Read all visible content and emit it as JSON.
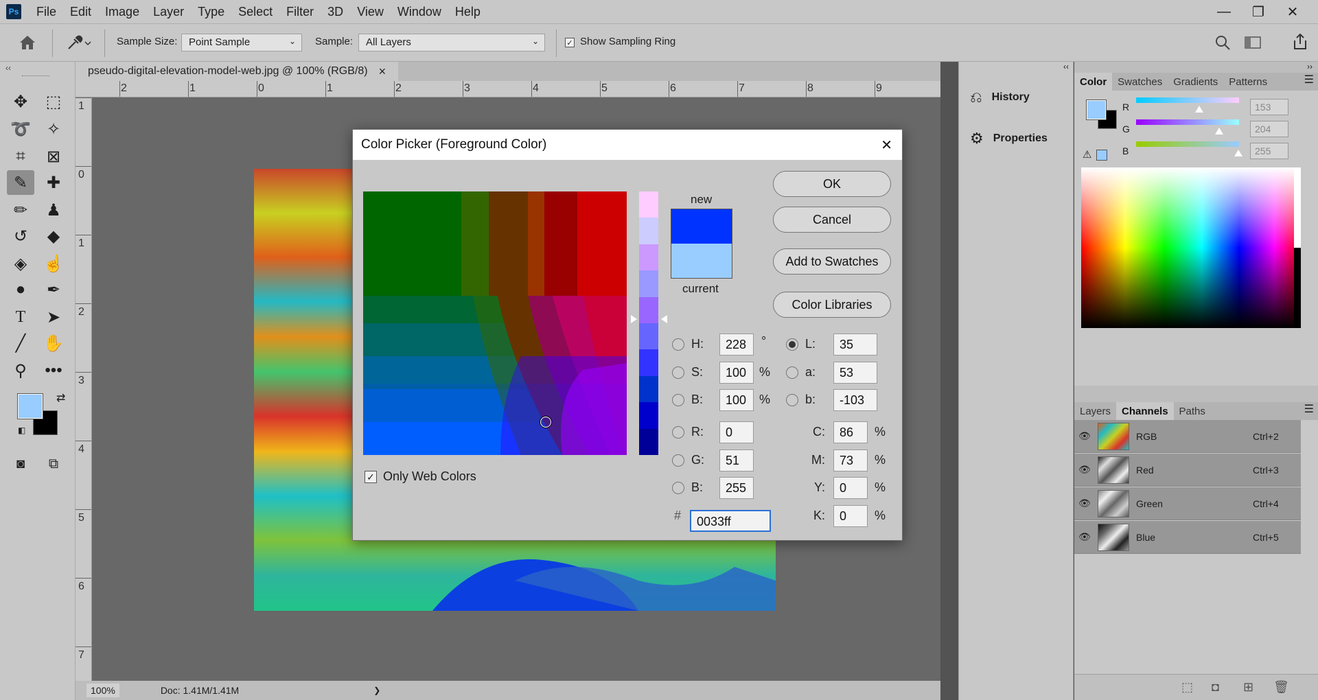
{
  "app": {
    "logo": "Ps"
  },
  "menu": [
    "File",
    "Edit",
    "Image",
    "Layer",
    "Type",
    "Select",
    "Filter",
    "3D",
    "View",
    "Window",
    "Help"
  ],
  "window_controls": {
    "minimize": "—",
    "restore": "❐",
    "close": "✕"
  },
  "options": {
    "sample_size_label": "Sample Size:",
    "sample_size_value": "Point Sample",
    "sample_label": "Sample:",
    "sample_value": "All Layers",
    "show_ring_label": "Show Sampling Ring",
    "show_ring_checked": true
  },
  "document": {
    "tab_title": "pseudo-digital-elevation-model-web.jpg @ 100% (RGB/8)",
    "tab_close": "×",
    "ruler_top": [
      "2",
      "1",
      "0",
      "1",
      "2",
      "3",
      "4",
      "5",
      "6",
      "7",
      "8",
      "9"
    ],
    "ruler_left": [
      "1",
      "0",
      "1",
      "2",
      "3",
      "4",
      "5",
      "6",
      "7"
    ],
    "zoom": "100%",
    "doc_size": "Doc: 1.41M/1.41M",
    "status_arrow": "❯"
  },
  "mid_panel": {
    "items": [
      {
        "label": "History",
        "icon": "history-icon"
      },
      {
        "label": "Properties",
        "icon": "properties-icon"
      }
    ]
  },
  "color_panel": {
    "tabs": [
      "Color",
      "Swatches",
      "Gradients",
      "Patterns"
    ],
    "sliders": [
      {
        "label": "R",
        "value": "153"
      },
      {
        "label": "G",
        "value": "204"
      },
      {
        "label": "B",
        "value": "255"
      }
    ],
    "foreground": "#99ccff",
    "background": "#000000"
  },
  "channels_panel": {
    "tabs": [
      "Layers",
      "Channels",
      "Paths"
    ],
    "rows": [
      {
        "name": "RGB",
        "shortcut": "Ctrl+2"
      },
      {
        "name": "Red",
        "shortcut": "Ctrl+3"
      },
      {
        "name": "Green",
        "shortcut": "Ctrl+4"
      },
      {
        "name": "Blue",
        "shortcut": "Ctrl+5"
      }
    ]
  },
  "color_picker": {
    "title": "Color Picker (Foreground Color)",
    "close": "✕",
    "new_label": "new",
    "current_label": "current",
    "new_color": "#0033ff",
    "current_color": "#99ccff",
    "buttons": {
      "ok": "OK",
      "cancel": "Cancel",
      "add": "Add to Swatches",
      "libraries": "Color Libraries"
    },
    "only_web_colors": "Only Web Colors",
    "fields": {
      "H": {
        "label": "H:",
        "value": "228",
        "unit": "°"
      },
      "S": {
        "label": "S:",
        "value": "100",
        "unit": "%"
      },
      "Bv": {
        "label": "B:",
        "value": "100",
        "unit": "%"
      },
      "R": {
        "label": "R:",
        "value": "0"
      },
      "G": {
        "label": "G:",
        "value": "51"
      },
      "Bc": {
        "label": "B:",
        "value": "255"
      },
      "L": {
        "label": "L:",
        "value": "35"
      },
      "a": {
        "label": "a:",
        "value": "53"
      },
      "b": {
        "label": "b:",
        "value": "-103"
      },
      "C": {
        "label": "C:",
        "value": "86",
        "unit": "%"
      },
      "M": {
        "label": "M:",
        "value": "73",
        "unit": "%"
      },
      "Y": {
        "label": "Y:",
        "value": "0",
        "unit": "%"
      },
      "K": {
        "label": "K:",
        "value": "0",
        "unit": "%"
      }
    },
    "hex_label": "#",
    "hex_value": "0033ff"
  }
}
